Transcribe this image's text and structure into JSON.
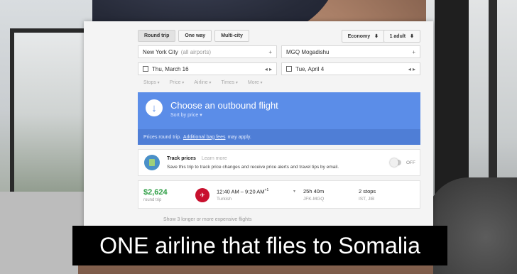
{
  "trip_types": [
    {
      "label": "Round trip",
      "active": true
    },
    {
      "label": "One way",
      "active": false
    },
    {
      "label": "Multi-city",
      "active": false
    }
  ],
  "cabin": {
    "label": "Economy",
    "icon": "chevron-updown-icon"
  },
  "passengers": {
    "label": "1 adult",
    "icon": "chevron-updown-icon"
  },
  "origin": {
    "city": "New York City",
    "detail": "(all airports)",
    "icon": "plus-icon",
    "icon_glyph": "+"
  },
  "destination": {
    "city": "MGQ Mogadishu",
    "icon": "plus-icon",
    "icon_glyph": "+"
  },
  "depart": {
    "date": "Thu, March 16",
    "icon": "calendar-icon",
    "nav": "◂ ▸"
  },
  "return": {
    "date": "Tue, April 4",
    "icon": "calendar-icon",
    "nav": "◂ ▸"
  },
  "filters": [
    "Stops",
    "Price",
    "Airline",
    "Times",
    "More"
  ],
  "banner": {
    "icon": "arrow-down-icon",
    "icon_glyph": "↓",
    "title": "Choose an outbound flight",
    "sort": "Sort by price ▾",
    "note_prefix": "Prices round trip.",
    "note_link": "Additional bag fees",
    "note_suffix": "may apply.",
    "color": "#5b8de8"
  },
  "track": {
    "title": "Track prices",
    "learn_more": "Learn more",
    "description": "Save this trip to track price changes and receive price alerts and travel tips by email.",
    "toggle_label": "OFF",
    "toggle_on": false
  },
  "flight": {
    "price": "$2,624",
    "price_sub": "round trip",
    "times": "12:40 AM – 9:20 AM",
    "day_offset": "+1",
    "airline": "Turkish",
    "airline_color": "#c8102e",
    "duration": "25h 40m",
    "route": "JFK-MGQ",
    "stops": "2 stops",
    "via": "IST, JIB"
  },
  "more_flights": "Show 3 longer or more expensive flights",
  "caption": "ONE airline that flies to Somalia"
}
